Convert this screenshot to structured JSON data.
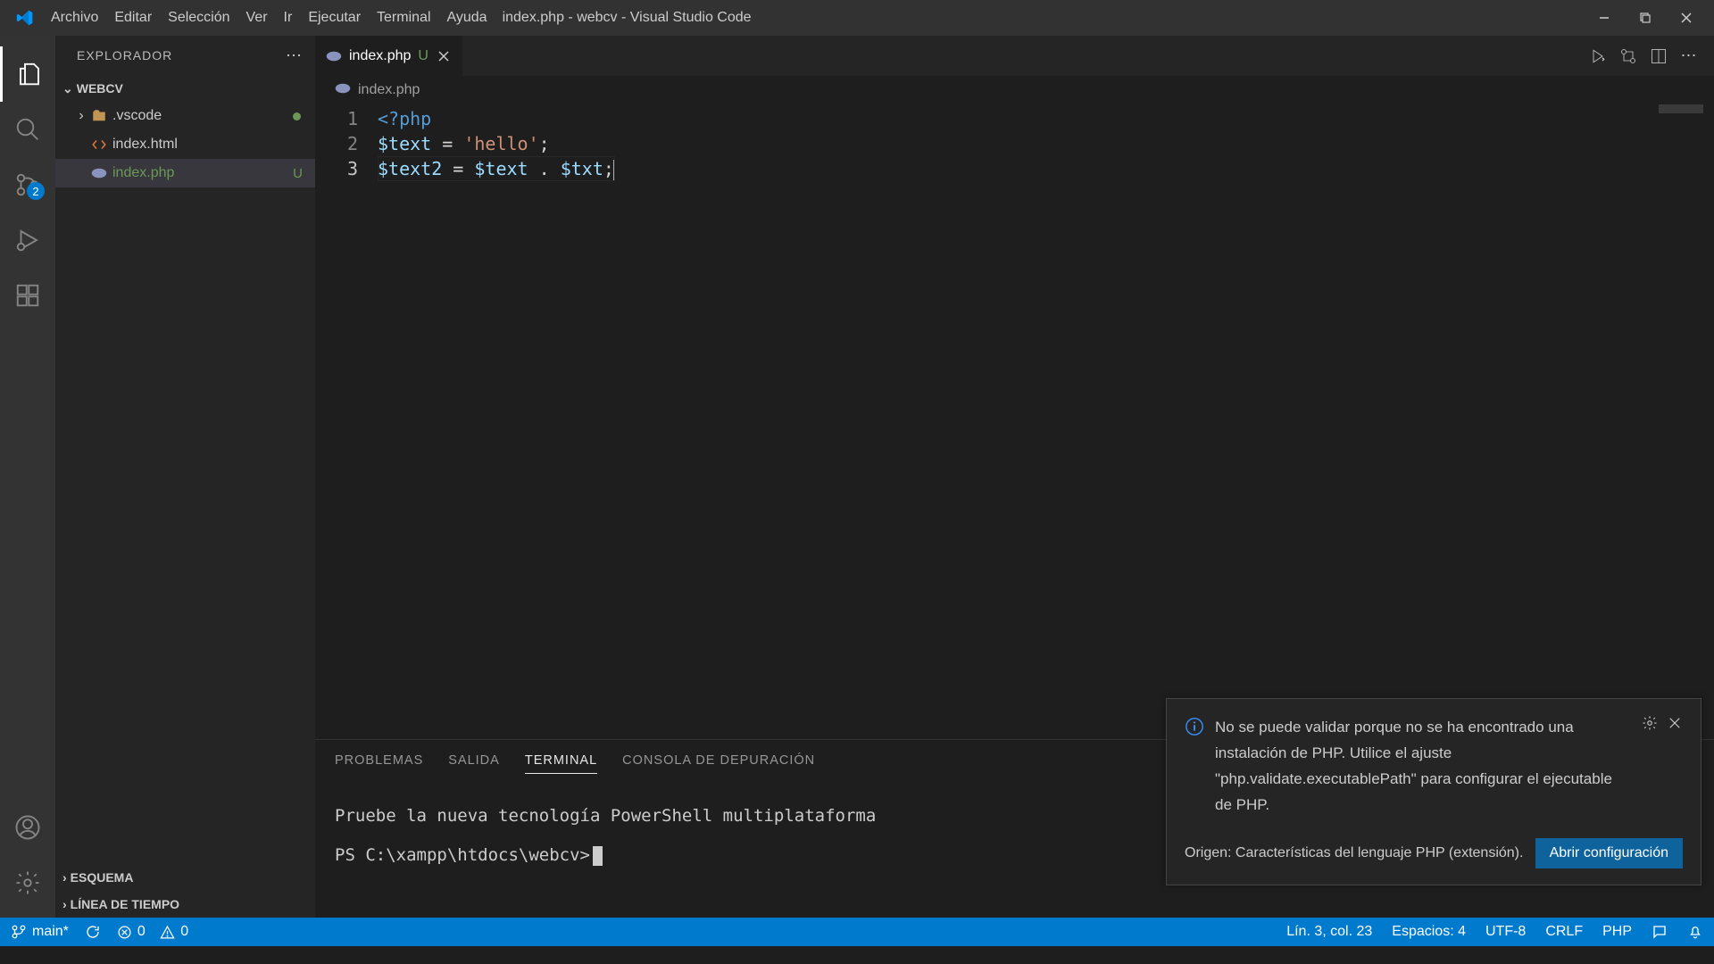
{
  "title": "index.php - webcv - Visual Studio Code",
  "menu": [
    "Archivo",
    "Editar",
    "Selección",
    "Ver",
    "Ir",
    "Ejecutar",
    "Terminal",
    "Ayuda"
  ],
  "activity_badge": "2",
  "sidebar": {
    "title": "EXPLORADOR",
    "workspace": "WEBCV",
    "items": [
      {
        "label": ".vscode",
        "kind": "folder",
        "dotted": true
      },
      {
        "label": "index.html",
        "kind": "html"
      },
      {
        "label": "index.php",
        "kind": "php",
        "badge": "U",
        "selected": true
      }
    ],
    "esquema": "ESQUEMA",
    "timeline": "LÍNEA DE TIEMPO"
  },
  "tab": {
    "name": "index.php",
    "status": "U"
  },
  "breadcrumb": "index.php",
  "code": {
    "lines": [
      "1",
      "2",
      "3"
    ],
    "l1_open": "<?php",
    "l2_var": "$text",
    "l2_rest": " = ",
    "l2_str": "'hello'",
    "l2_semi": ";",
    "l3_var1": "$text2",
    "l3_eq": " = ",
    "l3_var2": "$text",
    "l3_dot": " . ",
    "l3_var3": "$txt",
    "l3_semi": ";"
  },
  "panel": {
    "tabs": [
      "PROBLEMAS",
      "SALIDA",
      "TERMINAL",
      "CONSOLA DE DEPURACIÓN"
    ],
    "msg": "Pruebe la nueva tecnología PowerShell multiplataforma",
    "prompt": "PS C:\\xampp\\htdocs\\webcv>"
  },
  "notification": {
    "text": "No se puede validar porque no se ha encontrado una instalación de PHP. Utilice el ajuste \"php.validate.executablePath\" para configurar el ejecutable de PHP.",
    "source": "Origen: Características del lenguaje PHP (extensión).",
    "button": "Abrir configuración"
  },
  "status": {
    "branch": "main*",
    "errors": "0",
    "warnings": "0",
    "position": "Lín. 3, col. 23",
    "spaces": "Espacios: 4",
    "encoding": "UTF-8",
    "eol": "CRLF",
    "lang": "PHP"
  }
}
